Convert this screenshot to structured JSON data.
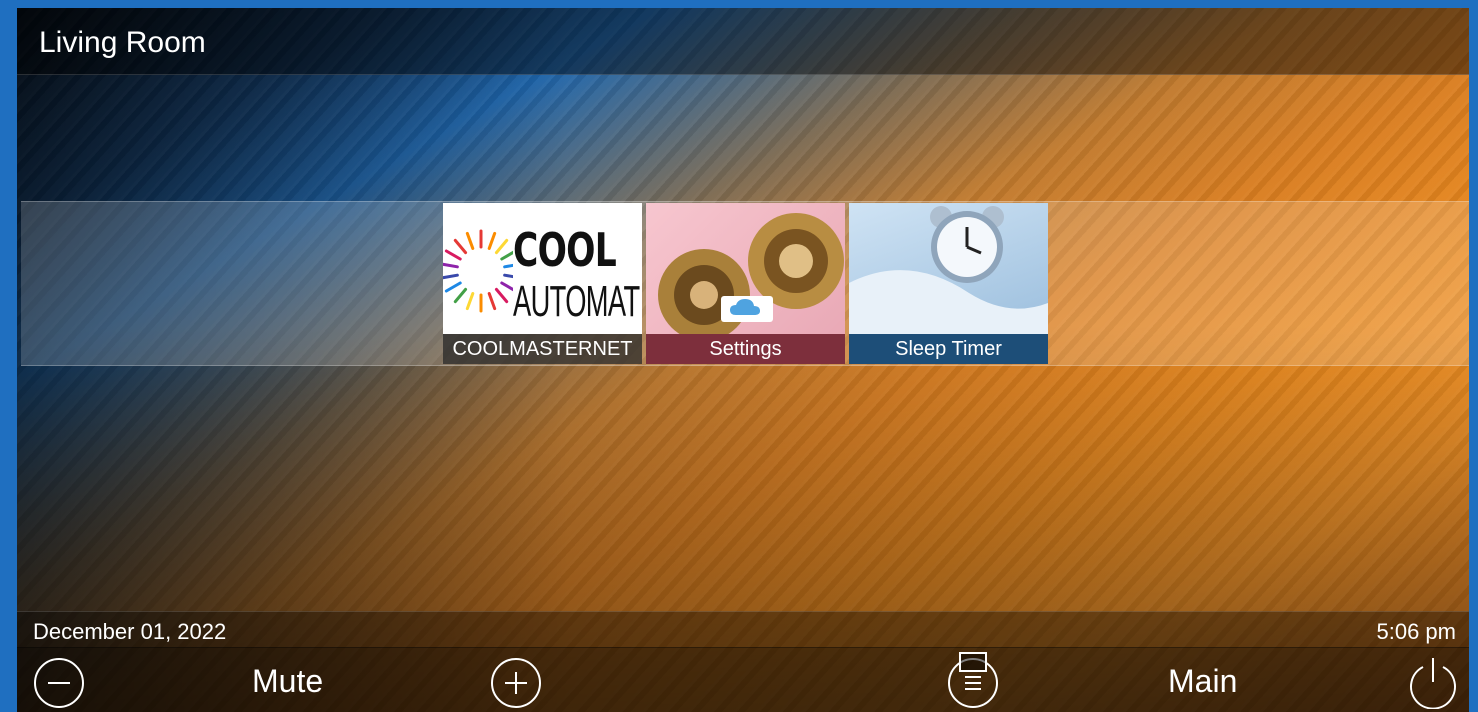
{
  "header": {
    "room": "Living Room"
  },
  "tiles": [
    {
      "label": "COOLMASTERNET",
      "logo_line1": "COOL",
      "logo_line2": "AUTOMATION",
      "icon": "coolautomation-logo"
    },
    {
      "label": "Settings",
      "icon": "gears-icon"
    },
    {
      "label": "Sleep Timer",
      "icon": "alarm-clock-icon"
    }
  ],
  "status": {
    "date": "December 01, 2022",
    "time": "5:06 pm"
  },
  "controls": {
    "volume_down_icon": "minus-circle-icon",
    "mute_label": "Mute",
    "volume_up_icon": "plus-circle-icon",
    "menu_icon": "menu-icon",
    "main_label": "Main",
    "power_icon": "power-icon"
  },
  "colors": {
    "frame": "#1f6fc0",
    "settings_caption": "#7d2f3c",
    "sleep_caption": "#1d4e78"
  }
}
